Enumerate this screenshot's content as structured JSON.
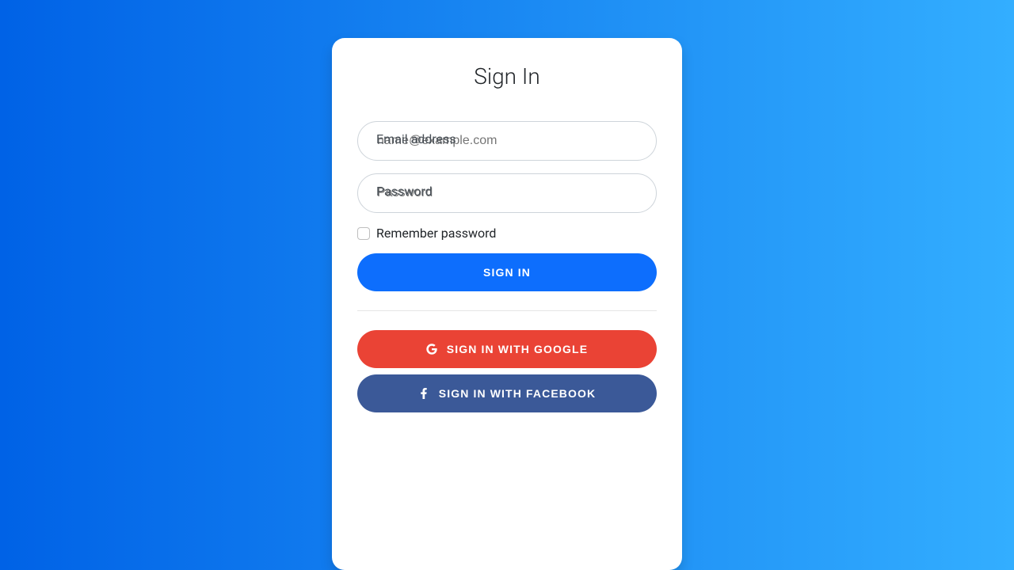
{
  "card": {
    "title": "Sign In"
  },
  "form": {
    "email": {
      "placeholder": "name@example.com",
      "label": "Email address",
      "value": ""
    },
    "password": {
      "placeholder": "Password",
      "label": "Password",
      "value": ""
    },
    "remember": {
      "label": "Remember password"
    },
    "submit": {
      "label": "Sign in"
    }
  },
  "social": {
    "google": {
      "label": "Sign in with Google"
    },
    "facebook": {
      "label": "Sign in with Facebook"
    }
  },
  "colors": {
    "gradient_start": "#0062E6",
    "gradient_end": "#33AEFF",
    "primary": "#0d6efd",
    "google": "#ea4335",
    "facebook": "#3b5998"
  }
}
